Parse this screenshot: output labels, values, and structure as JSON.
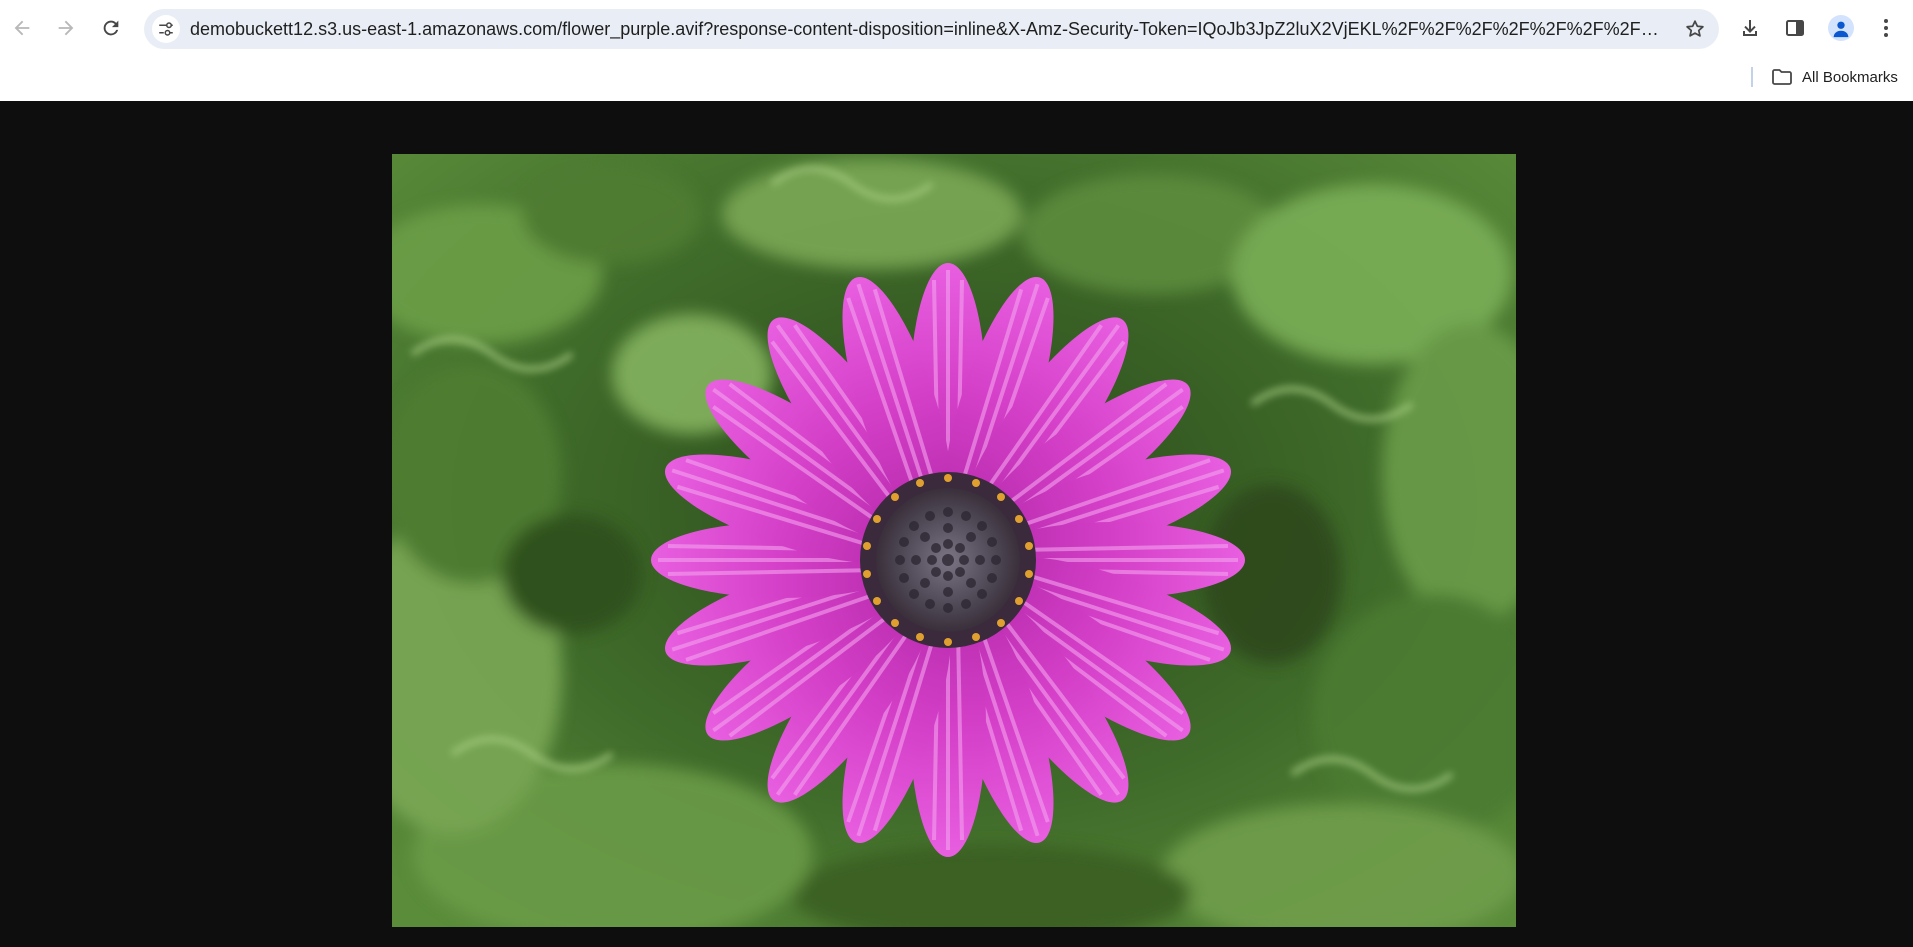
{
  "browser": {
    "url": "demobuckett12.s3.us-east-1.amazonaws.com/flower_purple.avif?response-content-disposition=inline&X-Amz-Security-Token=IQoJb3JpZ2luX2VjEKL%2F%2F%2F%2F%2F%2F%2F%2F%2F%2F...",
    "nav_icons": [
      "back-arrow-icon",
      "forward-arrow-icon",
      "reload-icon"
    ],
    "site_info_icon": "tune-icon",
    "bookmark_star_icon": "star-icon",
    "right_icons": [
      "download-icon",
      "side-panel-icon",
      "profile-icon",
      "kebab-menu-icon"
    ]
  },
  "bookmarks_bar": {
    "all_bookmarks_label": "All Bookmarks",
    "folder_icon": "folder-icon"
  },
  "viewer": {
    "background": "#0e0e0e",
    "image": {
      "subject": "purple daisy",
      "petal_color": "#d43fc8",
      "center_color": "#4b4552",
      "foliage_color": "#3f6b2a"
    }
  },
  "colors": {
    "omnibox_bg": "#e9eef6",
    "icon_gray": "#474747",
    "disabled_icon": "#b8b8b8",
    "avatar_bg": "#d3e3fd",
    "avatar_fg": "#0b57d0"
  }
}
